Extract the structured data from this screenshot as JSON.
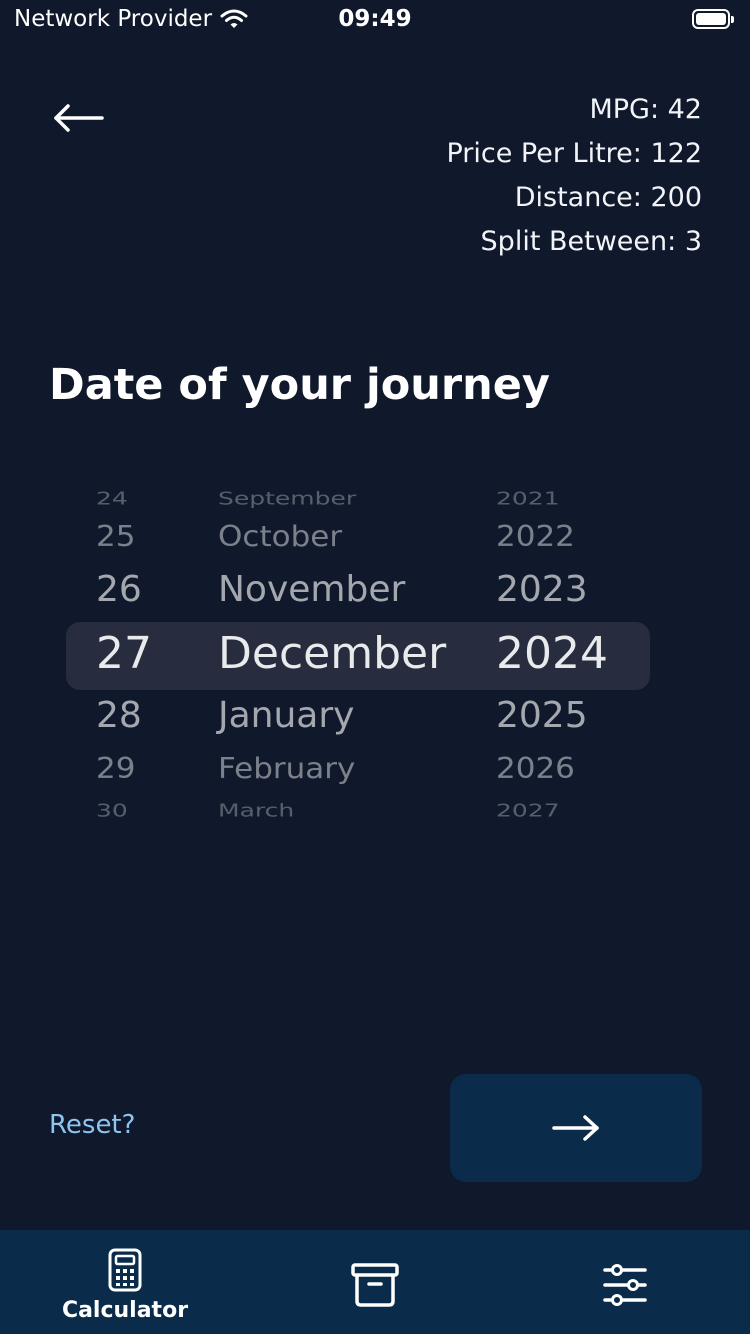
{
  "status_bar": {
    "carrier": "Network Provider",
    "time": "09:49"
  },
  "summary": {
    "mpg": "MPG: 42",
    "price_per_litre": "Price Per Litre: 122",
    "distance": "Distance: 200",
    "split_between": "Split Between: 3"
  },
  "title": "Date of your journey",
  "picker": {
    "days": [
      "24",
      "25",
      "26",
      "27",
      "28",
      "29",
      "30"
    ],
    "months": [
      "September",
      "October",
      "November",
      "December",
      "January",
      "February",
      "March"
    ],
    "years": [
      "2021",
      "2022",
      "2023",
      "2024",
      "2025",
      "2026",
      "2027"
    ],
    "selected": {
      "day": "27",
      "month": "December",
      "year": "2024"
    }
  },
  "reset_label": "Reset?",
  "tabs": [
    {
      "label": "Calculator",
      "icon": "calculator-icon"
    },
    {
      "label": "",
      "icon": "archive-icon"
    },
    {
      "label": "",
      "icon": "sliders-icon"
    }
  ],
  "colors": {
    "background": "#10182b",
    "accent": "#0a2c4a",
    "link": "#8fc3f0",
    "picker_highlight": "#272d3f"
  }
}
